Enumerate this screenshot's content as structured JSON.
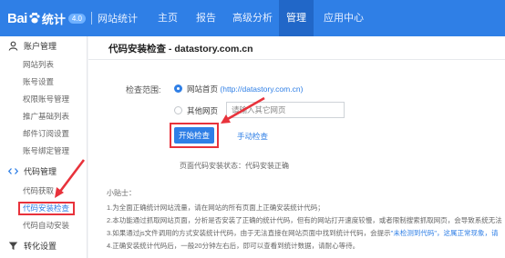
{
  "header": {
    "logo_text": "Bai",
    "logo_tongji": "统计",
    "badge": "4.0",
    "site_title": "网站统计",
    "nav": [
      {
        "label": "主页",
        "active": false
      },
      {
        "label": "报告",
        "active": false
      },
      {
        "label": "高级分析",
        "active": false
      },
      {
        "label": "管理",
        "active": true
      },
      {
        "label": "应用中心",
        "active": false
      }
    ]
  },
  "sidebar": {
    "groups": [
      {
        "label": "账户管理",
        "icon": "person-icon"
      },
      {
        "label": "代码管理",
        "icon": "code-icon"
      },
      {
        "label": "转化设置",
        "icon": "funnel-icon"
      }
    ],
    "account_items": [
      "网站列表",
      "账号设置",
      "权限账号管理",
      "推广基础列表",
      "邮件订阅设置",
      "账号绑定管理"
    ],
    "code_items": [
      "代码获取",
      "代码安装检查",
      "代码自动安装"
    ],
    "current_item": "代码安装检查"
  },
  "main": {
    "title": "代码安装检查 - datastory.com.cn",
    "scope_label": "检查范围:",
    "option_home": "网站首页",
    "option_home_url": "(http://datastory.com.cn)",
    "option_other": "其他网页",
    "input_placeholder": "请输入其它网页",
    "check_button": "开始检查",
    "manual_link": "手动检查",
    "status_text": "页面代码安装状态：代码安装正确",
    "tips_title": "小贴士：",
    "tips": [
      {
        "text": "1.为全面正确统计网站流量，请在网站的所有页面上正确安装统计代码；",
        "hl": ""
      },
      {
        "text": "2.本功能通过抓取网站页面，分析是否安装了正确的统计代码，但有的网站打开速度较慢，或者限制搜索抓取网页，会导致系统无法",
        "hl": ""
      },
      {
        "text": "3.如果通过js文件调用的方式安装统计代码，由于无法直接在网站页面中找到统计代码，会提示",
        "hl": "\"未检测到代码\"，这属正常现象，请"
      },
      {
        "text": "4.正确安装统计代码后，一般20分钟左右后，即可以查看到统计数据，请耐心等待。",
        "hl": ""
      }
    ]
  },
  "colors": {
    "brand_blue": "#2f7fe6",
    "nav_active": "#2167c8",
    "annotation_red": "#e8323b"
  }
}
